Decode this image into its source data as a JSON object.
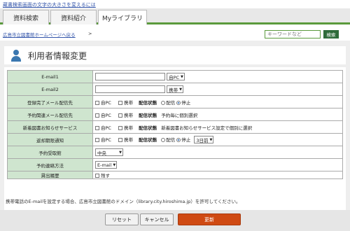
{
  "header": {
    "font_size_link": "蔵書検索画面の文字の大きさを変えるには",
    "tabs": [
      {
        "label": "資料検索"
      },
      {
        "label": "資料紹介"
      },
      {
        "label": "Myライブラリ"
      }
    ]
  },
  "breadcrumb": {
    "home_link": "広島市立図書館ホームページへ戻る",
    "separator": ">"
  },
  "search": {
    "placeholder": "キーワードなど",
    "button_label": "検索"
  },
  "page": {
    "title": "利用者情報変更"
  },
  "form": {
    "rows": {
      "email1": {
        "label": "E-mail1",
        "type_value": "自PC"
      },
      "email2": {
        "label": "E-mail2",
        "type_value": "携帯"
      },
      "reg_mail": {
        "label": "登録完了メール配信先",
        "opt_pc": "自PC",
        "opt_mobile": "携帯",
        "status_label": "配信状態",
        "status_on": "配信",
        "status_off": "停止"
      },
      "reserve_mail": {
        "label": "予約関連メール配信先",
        "opt_pc": "自PC",
        "opt_mobile": "携帯",
        "status_label": "配信状態",
        "status_text": "予約毎に個別選択"
      },
      "new_books": {
        "label": "新着図書お知らせサービス",
        "opt_pc": "自PC",
        "opt_mobile": "携帯",
        "status_label": "配信状態",
        "status_text": "新着図書お知らせサービス設定で個別に選択"
      },
      "due_notice": {
        "label": "返却期限通知",
        "opt_pc": "自PC",
        "opt_mobile": "携帯",
        "status_label": "配信状態",
        "status_on": "配信",
        "status_off": "停止",
        "days_value": "3日前"
      },
      "pickup": {
        "label": "予約受取館",
        "value": "中央"
      },
      "contact": {
        "label": "予約連絡方法",
        "value": "E-mail"
      },
      "history": {
        "label": "貸出履歴",
        "option": "残す"
      }
    }
  },
  "note": "携帯電話のE-mailを設定する場合、広島市立図書館のドメイン（library.city.hiroshima.jp）を許可してください。",
  "buttons": {
    "reset": "リセット",
    "cancel": "キャンセル",
    "update": "更新"
  },
  "colors": {
    "accent_green": "#5a9a3c",
    "label_bg": "#cfe5cf",
    "update_button": "#cf4a13",
    "icon_blue": "#3a77b0"
  }
}
